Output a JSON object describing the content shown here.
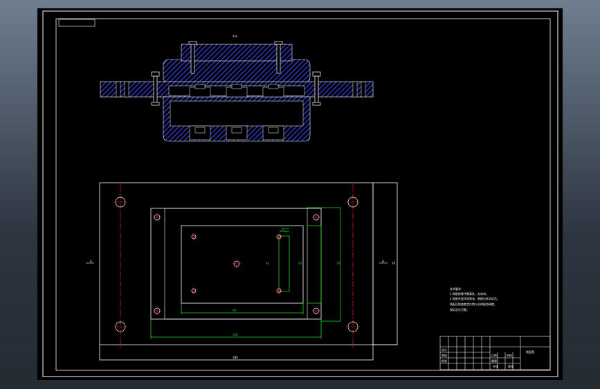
{
  "colors": {
    "background": "#000000",
    "line": "#ffffff",
    "hatch": "#3a48ff",
    "centerline": "#ff2020",
    "dimension": "#22dd22",
    "app_frame": "#4b5a6a"
  },
  "drawing": {
    "section_label": "A-A",
    "top_view": {
      "left_label": "A",
      "right_label": "A",
      "dim_inner_width": "90",
      "dim_outer_width": "140",
      "dim_overall_width": "180",
      "dim_small_width": "10",
      "dim_height_small": "40",
      "dim_height_mid": "50",
      "dim_height_large": "70",
      "right_side_label": "70"
    },
    "tech_requirements": {
      "title": "技术要求",
      "lines": [
        "1.装配前零件需清洗，去毛刺。",
        "2.各配合面涂润滑油，装配后转动灵活。",
        "装配后检查各定位销与孔的配合精度，",
        "保证定位可靠。"
      ]
    },
    "title_block": {
      "drawing_name": "装配图",
      "cells": [
        "设计",
        "审核",
        "批准",
        "比例",
        "材料",
        "重量",
        "共张",
        "第张"
      ]
    }
  }
}
